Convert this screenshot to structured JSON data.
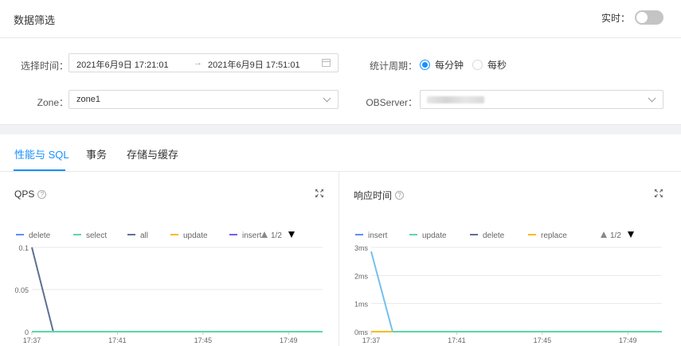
{
  "filter": {
    "title": "数据筛选",
    "realtime_label": "实时：",
    "time_label": "选择时间：",
    "time_start": "2021年6月9日 17:21:01",
    "time_sep": "→",
    "time_end": "2021年6月9日 17:51:01",
    "period_label": "统计周期：",
    "period_options": [
      "每分钟",
      "每秒"
    ],
    "period_selected": "每分钟",
    "zone_label": "Zone：",
    "zone_value": "zone1",
    "observer_label": "OBServer：",
    "observer_value": ""
  },
  "tabs": [
    "性能与 SQL",
    "事务",
    "存储与缓存"
  ],
  "active_tab": "性能与 SQL",
  "panels": {
    "qps": {
      "title": "QPS",
      "pager": "1/2",
      "legend": [
        {
          "name": "delete",
          "color": "#5b8ff9"
        },
        {
          "name": "select",
          "color": "#5ad8a6"
        },
        {
          "name": "all",
          "color": "#5d7092"
        },
        {
          "name": "update",
          "color": "#f6bd16"
        },
        {
          "name": "insert",
          "color": "#6f5ef9"
        }
      ]
    },
    "rt": {
      "title": "响应时间",
      "pager": "1/2",
      "legend": [
        {
          "name": "insert",
          "color": "#5b8ff9"
        },
        {
          "name": "update",
          "color": "#5ad8a6"
        },
        {
          "name": "delete",
          "color": "#5d7092"
        },
        {
          "name": "replace",
          "color": "#f6bd16"
        }
      ]
    }
  },
  "chart_data": [
    {
      "type": "line",
      "title": "QPS",
      "x": [
        "17:37",
        "17:38",
        "17:41",
        "17:45",
        "17:49",
        "17:51"
      ],
      "xticks": [
        "17:37",
        "17:41",
        "17:45",
        "17:49"
      ],
      "yticks": [
        "0",
        "0.05",
        "0.1"
      ],
      "ylim": [
        0,
        0.1
      ],
      "series": [
        {
          "name": "all",
          "color": "#5d7092",
          "values": [
            0.1,
            0,
            0,
            0,
            0,
            0
          ]
        },
        {
          "name": "select",
          "color": "#5ad8a6",
          "values": [
            0,
            0,
            0,
            0,
            0,
            0
          ]
        }
      ]
    },
    {
      "type": "line",
      "title": "响应时间",
      "x": [
        "17:37",
        "17:38",
        "17:41",
        "17:45",
        "17:49",
        "17:51"
      ],
      "xticks": [
        "17:37",
        "17:41",
        "17:45",
        "17:49"
      ],
      "yticks": [
        "0ms",
        "1ms",
        "2ms",
        "3ms"
      ],
      "ylim": [
        0,
        3
      ],
      "series": [
        {
          "name": "insert",
          "color": "#74c0f0",
          "values": [
            2.85,
            0,
            0,
            0,
            0,
            0
          ]
        },
        {
          "name": "update",
          "color": "#5ad8a6",
          "values": [
            0,
            0,
            0,
            0,
            0,
            0
          ]
        },
        {
          "name": "replace",
          "color": "#f6bd16",
          "values": [
            0,
            0,
            null,
            null,
            null,
            null
          ]
        }
      ]
    }
  ]
}
